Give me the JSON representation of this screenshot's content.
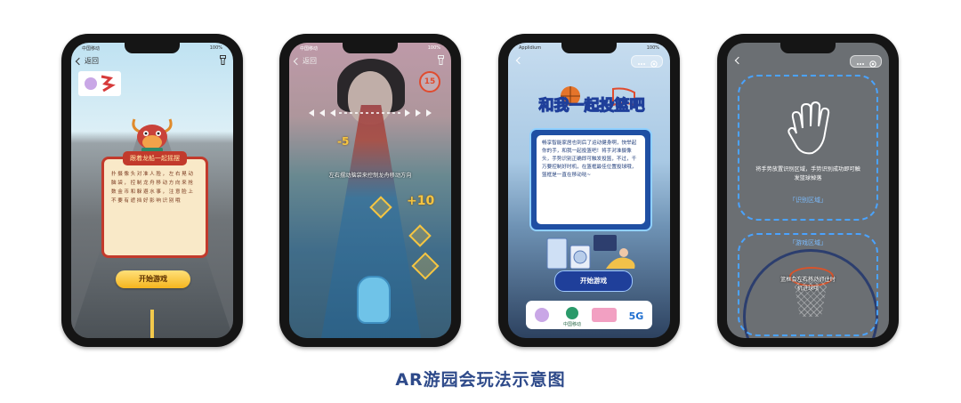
{
  "caption": "AR游园会玩法示意图",
  "phone1": {
    "status_left": "中国移动",
    "status_right": "100%",
    "back_label": "返回",
    "card_title": "跟着龙船一起摇摆",
    "card_text": "扑摄像头对准人脸，左右晃动脑袋，控制龙舟移动方向来抢数金币和躲避水事，注意脸上不要有遮挡好影响识别哦",
    "start_button": "开始游戏"
  },
  "phone2": {
    "status_left": "中国移动",
    "status_right": "100%",
    "back_label": "返回",
    "timer": "15",
    "hint": "左右摆动脑袋来控制龙舟移动方向",
    "score_minus": "-5",
    "score_plus": "+10"
  },
  "phone3": {
    "status_left": "Applidium",
    "status_right": "100%",
    "title": "和我一起投篮吧",
    "description": "畅享智能家居也到后了运动健身啊，快举起你的手，和我一起投篮吧！将手对准摄像头，手势识别正确即可触发投篮，不过，千万要控制好时机，在篮框最佳位置投球哦，篮框是一直在移动哒~",
    "start_button": "开始游戏",
    "footer_brand1": "中国移动",
    "footer_5g": "5G"
  },
  "phone4": {
    "instruction_top": "将手势放置识别区域，手势识别成功即可触发篮球掉落",
    "recognition_area_label": "「识别区域」",
    "game_area_label": "「游戏区域」",
    "instruction_bottom": "篮框会左右移动抓住时机进球哦"
  },
  "colors": {
    "caption": "#2e4a8a",
    "dashed": "#4aa3ff",
    "yellow_button": "#f5b51e",
    "navy_button": "#1f3f9a"
  }
}
